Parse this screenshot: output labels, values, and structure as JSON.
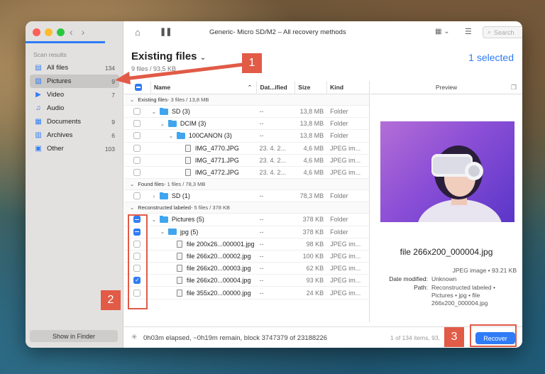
{
  "window": {
    "title": "Generic- Micro SD/M2 – All recovery methods",
    "search_placeholder": "Search"
  },
  "sidebar": {
    "section_title": "Scan results",
    "items": [
      {
        "label": "All files",
        "count": "134",
        "icon": "all-files-icon"
      },
      {
        "label": "Pictures",
        "count": "9",
        "icon": "pictures-icon"
      },
      {
        "label": "Video",
        "count": "7",
        "icon": "video-icon"
      },
      {
        "label": "Audio",
        "count": "",
        "icon": "audio-icon"
      },
      {
        "label": "Documents",
        "count": "9",
        "icon": "documents-icon"
      },
      {
        "label": "Archives",
        "count": "6",
        "icon": "archives-icon"
      },
      {
        "label": "Other",
        "count": "103",
        "icon": "other-icon"
      }
    ],
    "finder_button": "Show in Finder"
  },
  "header": {
    "title": "Existing files",
    "subtitle": "9 files / 93,5 KB",
    "selected": "1 selected"
  },
  "table": {
    "columns": [
      "Name",
      "Dat...ified",
      "Size",
      "Kind"
    ],
    "groups": [
      {
        "label": "Existing files",
        "meta": " - 3 files / 13,8 MB",
        "rows": [
          {
            "name": "SD (3)",
            "date": "--",
            "size": "13,8 MB",
            "kind": "Folder",
            "type": "folder",
            "indent": 0,
            "chevron": "⌄",
            "check": "empty"
          },
          {
            "name": "DCIM (3)",
            "date": "--",
            "size": "13,8 MB",
            "kind": "Folder",
            "type": "folder",
            "indent": 1,
            "chevron": "⌄",
            "check": "empty"
          },
          {
            "name": "100CANON (3)",
            "date": "--",
            "size": "13,8 MB",
            "kind": "Folder",
            "type": "folder",
            "indent": 2,
            "chevron": "⌄",
            "check": "empty"
          },
          {
            "name": "IMG_4770.JPG",
            "date": "23. 4. 2...",
            "size": "4,6 MB",
            "kind": "JPEG im...",
            "type": "file",
            "indent": 3,
            "chevron": "",
            "check": "empty"
          },
          {
            "name": "IMG_4771.JPG",
            "date": "23. 4. 2...",
            "size": "4,6 MB",
            "kind": "JPEG im...",
            "type": "file",
            "indent": 3,
            "chevron": "",
            "check": "empty"
          },
          {
            "name": "IMG_4772.JPG",
            "date": "23. 4. 2...",
            "size": "4,6 MB",
            "kind": "JPEG im...",
            "type": "file",
            "indent": 3,
            "chevron": "",
            "check": "empty"
          }
        ]
      },
      {
        "label": "Found files",
        "meta": " - 1 files / 78,3 MB",
        "rows": [
          {
            "name": "SD (1)",
            "date": "--",
            "size": "78,3 MB",
            "kind": "Folder",
            "type": "folder",
            "indent": 0,
            "chevron": "›",
            "check": "empty"
          }
        ]
      },
      {
        "label": "Reconstructed labeled",
        "meta": " - 5 files / 378 KB",
        "rows": [
          {
            "name": "Pictures (5)",
            "date": "--",
            "size": "378 KB",
            "kind": "Folder",
            "type": "folder",
            "indent": 0,
            "chevron": "⌄",
            "check": "minus"
          },
          {
            "name": "jpg (5)",
            "date": "--",
            "size": "378 KB",
            "kind": "Folder",
            "type": "folder",
            "indent": 1,
            "chevron": "⌄",
            "check": "minus"
          },
          {
            "name": "file 200x26...000001.jpg",
            "date": "--",
            "size": "98 KB",
            "kind": "JPEG im...",
            "type": "file",
            "indent": 2,
            "chevron": "",
            "check": "empty"
          },
          {
            "name": "file 266x20...00002.jpg",
            "date": "--",
            "size": "100 KB",
            "kind": "JPEG im...",
            "type": "file",
            "indent": 2,
            "chevron": "",
            "check": "empty"
          },
          {
            "name": "file 266x20...00003.jpg",
            "date": "--",
            "size": "62 KB",
            "kind": "JPEG im...",
            "type": "file",
            "indent": 2,
            "chevron": "",
            "check": "empty"
          },
          {
            "name": "file 266x20...00004.jpg",
            "date": "--",
            "size": "93 KB",
            "kind": "JPEG im...",
            "type": "file",
            "indent": 2,
            "chevron": "",
            "check": "checked"
          },
          {
            "name": "file 355x20...00000.jpg",
            "date": "--",
            "size": "24 KB",
            "kind": "JPEG im...",
            "type": "file",
            "indent": 2,
            "chevron": "",
            "check": "empty"
          }
        ]
      }
    ]
  },
  "preview": {
    "header": "Preview",
    "filename": "file 266x200_000004.jpg",
    "type_size": "JPEG image • 93.21 KB",
    "date_modified_label": "Date modified:",
    "date_modified_value": "Unknown",
    "path_label": "Path:",
    "path_value": "Reconstructed labeled • Pictures • jpg • file 266x200_000004.jpg"
  },
  "status": {
    "elapsed": "0h03m elapsed, ~0h19m remain, block 3747379 of 23188226",
    "items": "1 of 134 items, 93,",
    "recover_button": "Recover"
  },
  "annotations": [
    "1",
    "2",
    "3"
  ],
  "colors": {
    "accent": "#2f7cf6",
    "annotation": "#e15b47",
    "folder": "#41a5ee"
  }
}
